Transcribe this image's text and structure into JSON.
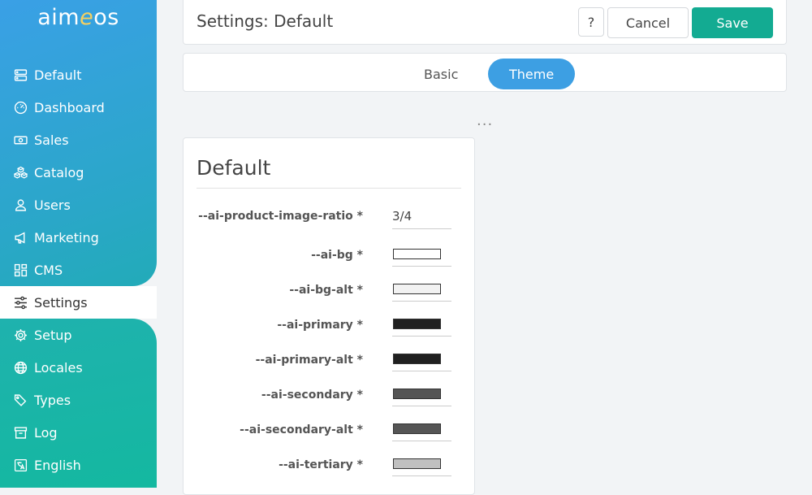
{
  "sidebar": {
    "logo_prefix": "aim",
    "logo_accent": "e",
    "logo_suffix": "os",
    "items": [
      {
        "label": "Default",
        "icon": "server-icon"
      },
      {
        "label": "Dashboard",
        "icon": "speedometer-icon"
      },
      {
        "label": "Sales",
        "icon": "cash-icon"
      },
      {
        "label": "Catalog",
        "icon": "boxes-icon"
      },
      {
        "label": "Users",
        "icon": "person-icon"
      },
      {
        "label": "Marketing",
        "icon": "megaphone-icon"
      },
      {
        "label": "CMS",
        "icon": "grid-icon"
      },
      {
        "label": "Settings",
        "icon": "sliders-icon"
      },
      {
        "label": "Setup",
        "icon": "gear-icon"
      },
      {
        "label": "Locales",
        "icon": "globe-icon"
      },
      {
        "label": "Types",
        "icon": "tags-icon"
      },
      {
        "label": "Log",
        "icon": "archive-icon"
      },
      {
        "label": "English",
        "icon": "translate-icon"
      }
    ],
    "active_item": "Settings"
  },
  "header": {
    "title": "Settings: Default",
    "help_label": "?",
    "cancel_label": "Cancel",
    "save_label": "Save"
  },
  "tabs": [
    {
      "label": "Basic",
      "active": false
    },
    {
      "label": "Theme",
      "active": true
    }
  ],
  "more_label": "...",
  "form": {
    "title": "Default",
    "fields": [
      {
        "label": "--ai-product-image-ratio *",
        "type": "text",
        "value": "3/4"
      },
      {
        "label": "--ai-bg *",
        "type": "color",
        "value": "#ffffff"
      },
      {
        "label": "--ai-bg-alt *",
        "type": "color",
        "value": "#f2f2f2"
      },
      {
        "label": "--ai-primary *",
        "type": "color",
        "value": "#202020"
      },
      {
        "label": "--ai-primary-alt *",
        "type": "color",
        "value": "#202020"
      },
      {
        "label": "--ai-secondary *",
        "type": "color",
        "value": "#555555"
      },
      {
        "label": "--ai-secondary-alt *",
        "type": "color",
        "value": "#555555"
      },
      {
        "label": "--ai-tertiary *",
        "type": "color",
        "value": "#c0c0c0"
      }
    ]
  },
  "colors": {
    "accent_blue": "#3d9fe3",
    "save_green": "#13ab92"
  }
}
